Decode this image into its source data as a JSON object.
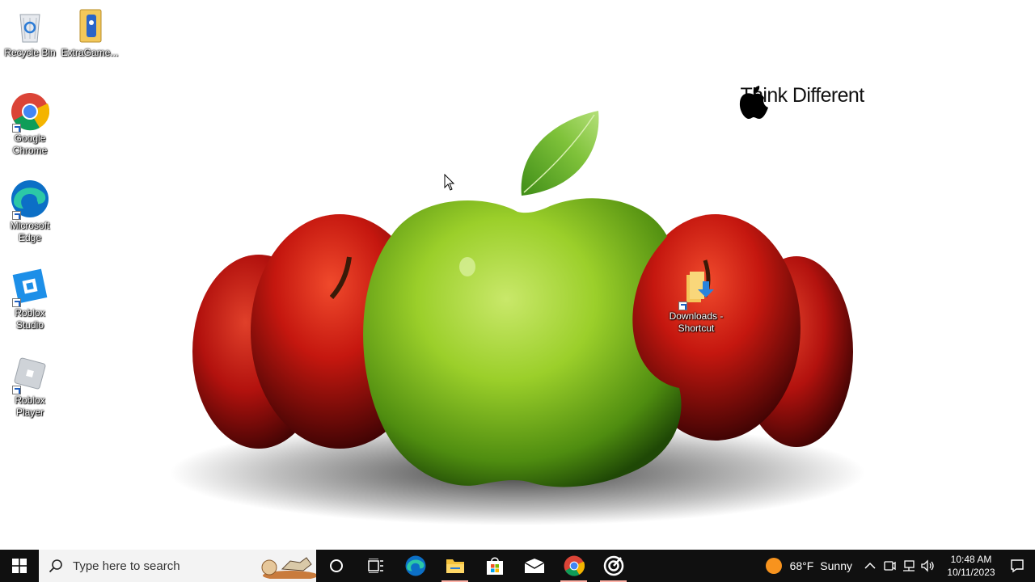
{
  "desktop": {
    "icons": [
      {
        "label": "Recycle Bin",
        "icon": "recycle-bin-icon"
      },
      {
        "label": "ExtraGame...",
        "icon": "game-file-icon"
      },
      {
        "label": "Google Chrome",
        "icon": "chrome-icon"
      },
      {
        "label": "Microsoft Edge",
        "icon": "edge-icon"
      },
      {
        "label": "Roblox Studio",
        "icon": "roblox-studio-icon"
      },
      {
        "label": "Roblox Player",
        "icon": "roblox-player-icon"
      },
      {
        "label": "Downloads - Shortcut",
        "icon": "downloads-folder-icon"
      }
    ]
  },
  "wallpaper": {
    "slogan": "Think Different",
    "logo": "apple-logo-icon"
  },
  "taskbar": {
    "start_icon": "windows-start-icon",
    "search_placeholder": "Type here to search",
    "apps": [
      "cortana-icon",
      "task-view-icon",
      "edge-icon",
      "file-explorer-icon",
      "microsoft-store-icon",
      "mail-icon",
      "chrome-icon",
      "target-app-icon"
    ],
    "weather": {
      "temp": "68°F",
      "condition": "Sunny"
    },
    "clock": {
      "time": "10:48 AM",
      "date": "10/11/2023"
    }
  },
  "colors": {
    "taskbar_bg": "#101010",
    "search_bg": "#f3f3f3",
    "accent_sun": "#f7931e"
  }
}
